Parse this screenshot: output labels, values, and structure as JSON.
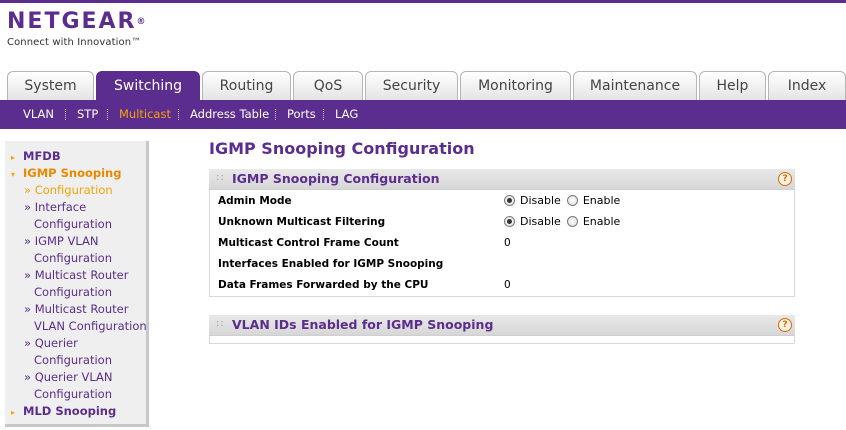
{
  "brand": {
    "name": "NETGEAR",
    "tm": "®",
    "tagline": "Connect with Innovation™"
  },
  "tabs": [
    {
      "label": "System"
    },
    {
      "label": "Switching"
    },
    {
      "label": "Routing"
    },
    {
      "label": "QoS"
    },
    {
      "label": "Security"
    },
    {
      "label": "Monitoring"
    },
    {
      "label": "Maintenance"
    },
    {
      "label": "Help"
    },
    {
      "label": "Index"
    }
  ],
  "active_tab": "Switching",
  "subnav": [
    {
      "label": "VLAN"
    },
    {
      "label": "STP"
    },
    {
      "label": "Multicast"
    },
    {
      "label": "Address Table"
    },
    {
      "label": "Ports"
    },
    {
      "label": "LAG"
    }
  ],
  "active_subnav": "Multicast",
  "sidebar": {
    "mfdb": "MFDB",
    "igmp": "IGMP Snooping",
    "items": [
      {
        "lines": [
          "» Configuration"
        ]
      },
      {
        "lines": [
          "» Interface",
          "Configuration"
        ]
      },
      {
        "lines": [
          "» IGMP VLAN",
          "Configuration"
        ]
      },
      {
        "lines": [
          "» Multicast Router",
          "Configuration"
        ]
      },
      {
        "lines": [
          "» Multicast Router",
          "VLAN Configuration"
        ]
      },
      {
        "lines": [
          "» Querier",
          "Configuration"
        ]
      },
      {
        "lines": [
          "» Querier VLAN",
          "Configuration"
        ]
      }
    ],
    "mld": "MLD Snooping"
  },
  "page_title": "IGMP Snooping Configuration",
  "panel_config": {
    "title": "IGMP Snooping Configuration",
    "help": "?",
    "rows": [
      {
        "label": "Admin Mode",
        "options": [
          "Disable",
          "Enable"
        ],
        "selected": "Disable"
      },
      {
        "label": "Unknown Multicast Filtering",
        "options": [
          "Disable",
          "Enable"
        ],
        "selected": "Disable"
      },
      {
        "label": "Multicast Control Frame Count",
        "value": "0"
      },
      {
        "label": "Interfaces Enabled for IGMP Snooping",
        "value": ""
      },
      {
        "label": "Data Frames Forwarded by the CPU",
        "value": "0"
      }
    ]
  },
  "panel_vlan": {
    "title": "VLAN IDs Enabled for IGMP Snooping",
    "help": "?"
  }
}
